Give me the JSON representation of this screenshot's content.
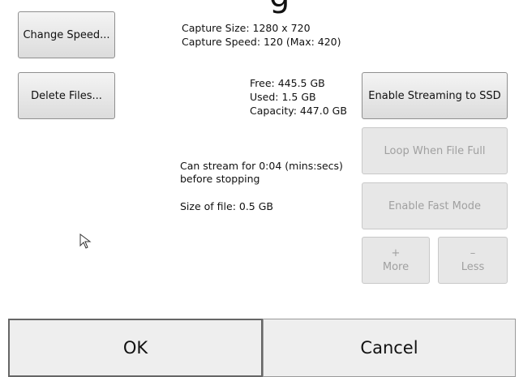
{
  "header": {
    "title_fragment": "g"
  },
  "buttons": {
    "change_speed": "Change Speed...",
    "delete_files": "Delete Files...",
    "enable_streaming": "Enable Streaming to SSD",
    "loop_when_full": "Loop When File Full",
    "enable_fast_mode": "Enable Fast Mode",
    "more_symbol": "+",
    "more_label": "More",
    "less_symbol": "–",
    "less_label": "Less",
    "ok": "OK",
    "cancel": "Cancel"
  },
  "capture": {
    "size": "Capture Size: 1280 x 720",
    "speed": "Capture Speed: 120  (Max: 420)"
  },
  "storage": {
    "free": "Free: 445.5 GB",
    "used": "Used: 1.5 GB",
    "capacity": "Capacity: 447.0 GB"
  },
  "stream": {
    "duration_line1": "Can stream for 0:04 (mins:secs)",
    "duration_line2": "before stopping",
    "file_size": "Size of file: 0.5 GB"
  }
}
